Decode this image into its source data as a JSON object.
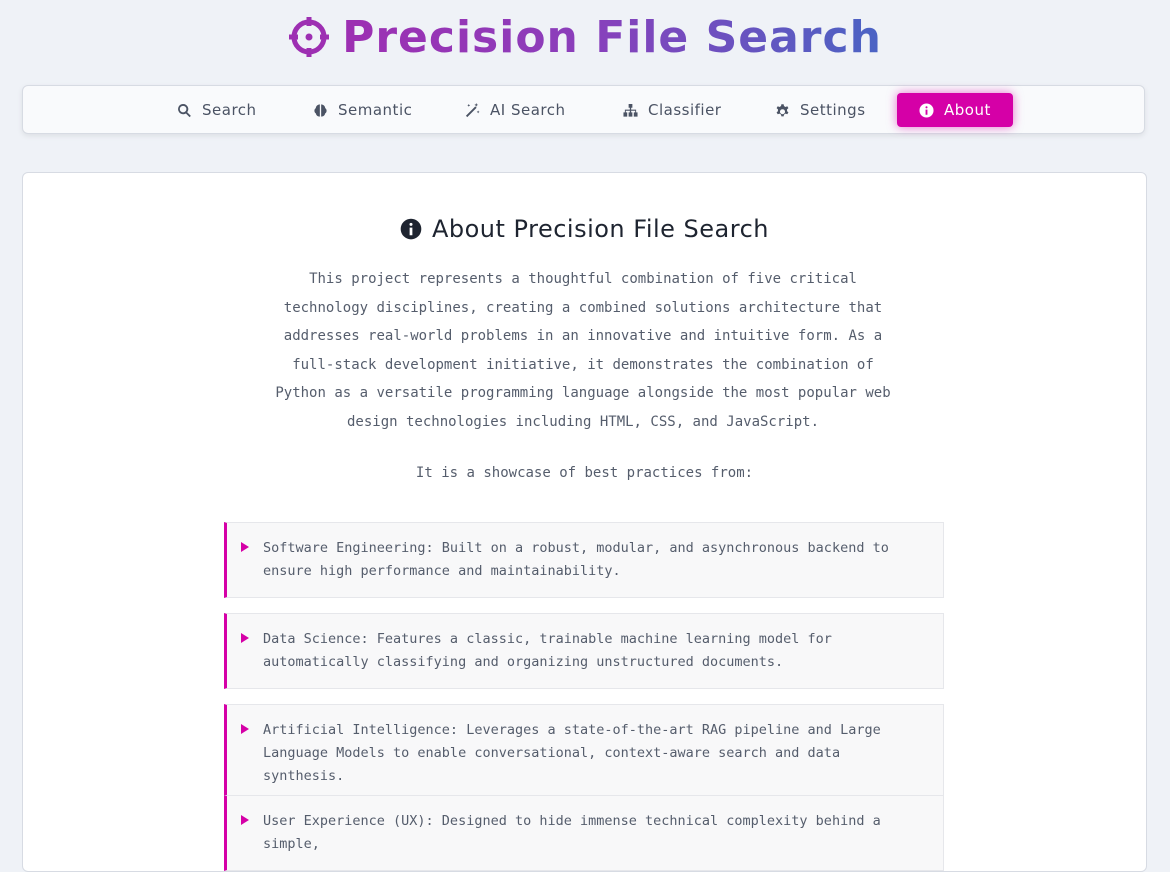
{
  "app": {
    "title": "Precision File Search",
    "title_icon": "crosshairs-icon",
    "accent": "#d500a7"
  },
  "nav": {
    "tabs": [
      {
        "label": "Search",
        "icon": "search-icon"
      },
      {
        "label": "Semantic",
        "icon": "brain-icon"
      },
      {
        "label": "AI Search",
        "icon": "magic-wand-icon"
      },
      {
        "label": "Classifier",
        "icon": "sitemap-icon"
      },
      {
        "label": "Settings",
        "icon": "gear-icon"
      },
      {
        "label": "About",
        "icon": "info-circle-icon",
        "active": true
      }
    ]
  },
  "about": {
    "heading": "About Precision File Search",
    "intro": "This project represents a thoughtful combination of five critical technology disciplines, creating a combined solutions architecture that addresses real-world problems in an innovative and intuitive form. As a full-stack development initiative, it demonstrates the combination of Python as a versatile programming language alongside the most popular web design technologies including HTML, CSS, and JavaScript.",
    "showcase": "It is a showcase of best practices from:",
    "items": [
      {
        "text": "Software Engineering: Built on a robust, modular, and asynchronous backend to ensure high performance and maintainability."
      },
      {
        "text": "Data Science: Features a classic, trainable machine learning model for automatically classifying and organizing unstructured documents."
      },
      {
        "text": "Artificial Intelligence: Leverages a state-of-the-art RAG pipeline and Large Language Models to enable conversational, context-aware search and data synthesis."
      },
      {
        "text": "User Experience (UX): Designed to hide immense technical complexity behind a simple,"
      }
    ]
  }
}
